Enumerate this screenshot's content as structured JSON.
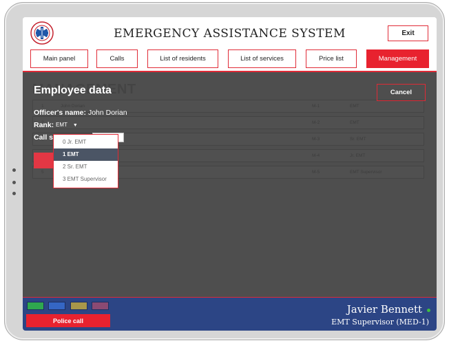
{
  "header": {
    "title": "EMERGENCY ASSISTANCE SYSTEM",
    "exit_label": "Exit",
    "logo_text": "EMERGENCY MEDICAL SERVICE"
  },
  "nav": [
    {
      "label": "Main panel",
      "active": false
    },
    {
      "label": "Calls",
      "active": false
    },
    {
      "label": "List of residents",
      "active": false
    },
    {
      "label": "List of services",
      "active": false
    },
    {
      "label": "Price list",
      "active": false
    },
    {
      "label": "Management",
      "active": true
    }
  ],
  "background": {
    "title": "MANAGEMENT",
    "rows": [
      {
        "id": "1",
        "name": "John Dorian",
        "code": "M-1",
        "rank": "EMT"
      },
      {
        "id": "2",
        "name": "",
        "code": "M-2",
        "rank": "EMT"
      },
      {
        "id": "3",
        "name": "",
        "code": "M-3",
        "rank": "Sr. EMT"
      },
      {
        "id": "4",
        "name": "",
        "code": "M-4",
        "rank": "Jr. EMT"
      },
      {
        "id": "5",
        "name": "",
        "code": "M-5",
        "rank": "EMT Supervisor"
      }
    ]
  },
  "employee": {
    "title": "Employee data",
    "cancel_label": "Cancel",
    "officer_label": "Officer's name:",
    "officer_name": "John Dorian",
    "rank_label": "Rank:",
    "rank_value": "EMT",
    "call_sign_label": "Call s",
    "call_sign_value": "e"
  },
  "rank_options": [
    {
      "label": "0 Jr. EMT",
      "selected": false
    },
    {
      "label": "1 EMT",
      "selected": true
    },
    {
      "label": "2 Sr. EMT",
      "selected": false
    },
    {
      "label": "3 EMT Supervisor",
      "selected": false
    }
  ],
  "footer": {
    "police_label": "Police call",
    "user_name": "Javier Bennett",
    "user_role": "EMT Supervisor (MED-1)",
    "status": "online",
    "swatches": [
      "#2fa84f",
      "#3566c4",
      "#a8974a",
      "#8b4a73"
    ]
  },
  "colors": {
    "accent": "#e8222f",
    "footer": "#2c4585",
    "dim": "#4e4e4e"
  }
}
